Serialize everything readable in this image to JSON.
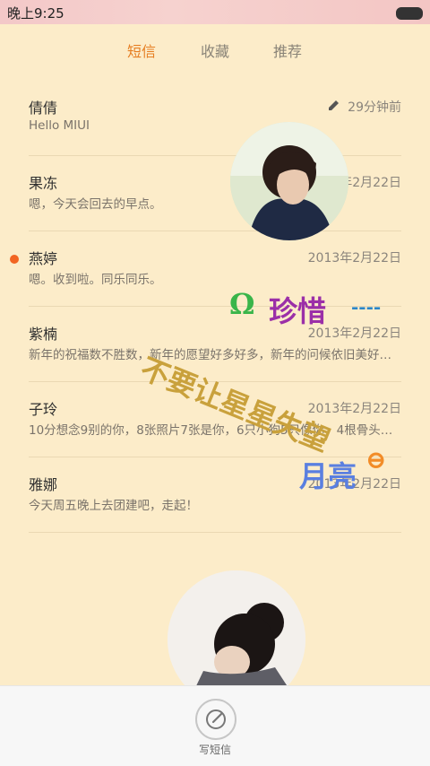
{
  "status_bar": {
    "time": "晚上9:25"
  },
  "tabs": [
    {
      "label": "短信",
      "active": true
    },
    {
      "label": "收藏",
      "active": false
    },
    {
      "label": "推荐",
      "active": false
    }
  ],
  "messages": [
    {
      "name": "倩倩",
      "preview": "Hello MIUI",
      "date": "29分钟前",
      "unread": false,
      "draft_icon": "pencil-icon"
    },
    {
      "name": "果冻",
      "preview": "嗯，今天会回去的早点。",
      "date": "2013年2月22日",
      "unread": false
    },
    {
      "name": "燕婷",
      "preview": "嗯。收到啦。同乐同乐。",
      "date": "2013年2月22日",
      "unread": true
    },
    {
      "name": "紫楠",
      "preview": "新年的祝福数不胜数，新年的愿望好多好多，新年的问候依旧美好…",
      "date": "2013年2月22日",
      "unread": false
    },
    {
      "name": "子玲",
      "preview": "10分想念9别的你，8张照片7张是你，6只小狗5只像你，4根骨头…",
      "date": "2013年2月22日",
      "unread": false
    },
    {
      "name": "雅娜",
      "preview": "今天周五晚上去团建吧，走起！",
      "date": "2013年2月22日",
      "unread": false
    }
  ],
  "decorations": {
    "line1": "珍惜",
    "line2": "不要让星星失望",
    "line3": "月亮"
  },
  "bottom_bar": {
    "compose_label": "写短信"
  },
  "colors": {
    "accent": "#e67e22",
    "unread_dot": "#f26522",
    "background": "#fcecc9"
  }
}
